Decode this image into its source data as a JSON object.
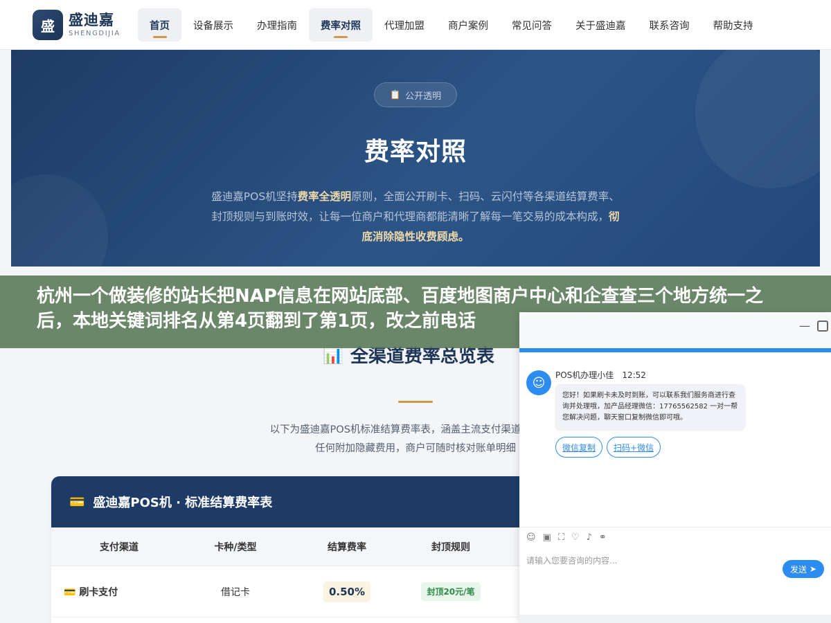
{
  "header": {
    "logo_mark": "盛",
    "logo_cn": "盛迪嘉",
    "logo_en": "SHENGDIJIA",
    "nav": [
      "首页",
      "设备展示",
      "办理指南",
      "费率对照",
      "代理加盟",
      "商户案例",
      "常见问答",
      "关于盛迪嘉",
      "联系咨询",
      "帮助支持"
    ]
  },
  "hero": {
    "badge": "公开透明",
    "title": "费率对照",
    "desc_1": "盛迪嘉POS机坚持",
    "desc_bold_1": "费率全透明",
    "desc_2": "原则，全面公开刷卡、扫码、云闪付等各渠道结算费率、封顶规则与到账时效，让每一位商户和代理商都能清晰了解每一笔交易的成本构成，",
    "desc_bold_2": "彻底消除隐性收费顾虑。"
  },
  "banner": {
    "text": "杭州一个做装修的站长把NAP信息在网站底部、百度地图商户中心和企查查三个地方统一之后，本地关键词排名从第4页翻到了第1页，改之前电话"
  },
  "section": {
    "title": "全渠道费率总览表",
    "desc_1": "以下为盛迪嘉POS机标准结算费率表，涵盖主流支付渠道。所有费",
    "desc_2": "任何附加隐藏费用，商户可随时核对账单明细"
  },
  "table": {
    "title": "盛迪嘉POS机 · 标准结算费率表",
    "headers": [
      "支付渠道",
      "卡种/类型",
      "结算费率",
      "封顶规则"
    ],
    "rows": [
      {
        "channel": "刷卡支付",
        "type": "借记卡",
        "rate": "0.50%",
        "cap": "封顶20元/笔"
      }
    ]
  },
  "chat": {
    "agent": "POS机办理小佳",
    "time": "12:52",
    "message": "您好！如果刷卡未及时到账，可以联系我们服务商进行查询并处理哦，加产品经理微信：17765562582 一对一帮您解决问题，聊天窗口复制微信即可哦。",
    "buttons": [
      "微信复制",
      "扫码+微信"
    ],
    "input_placeholder": "请输入您要咨询的内容...",
    "send": "发送"
  }
}
